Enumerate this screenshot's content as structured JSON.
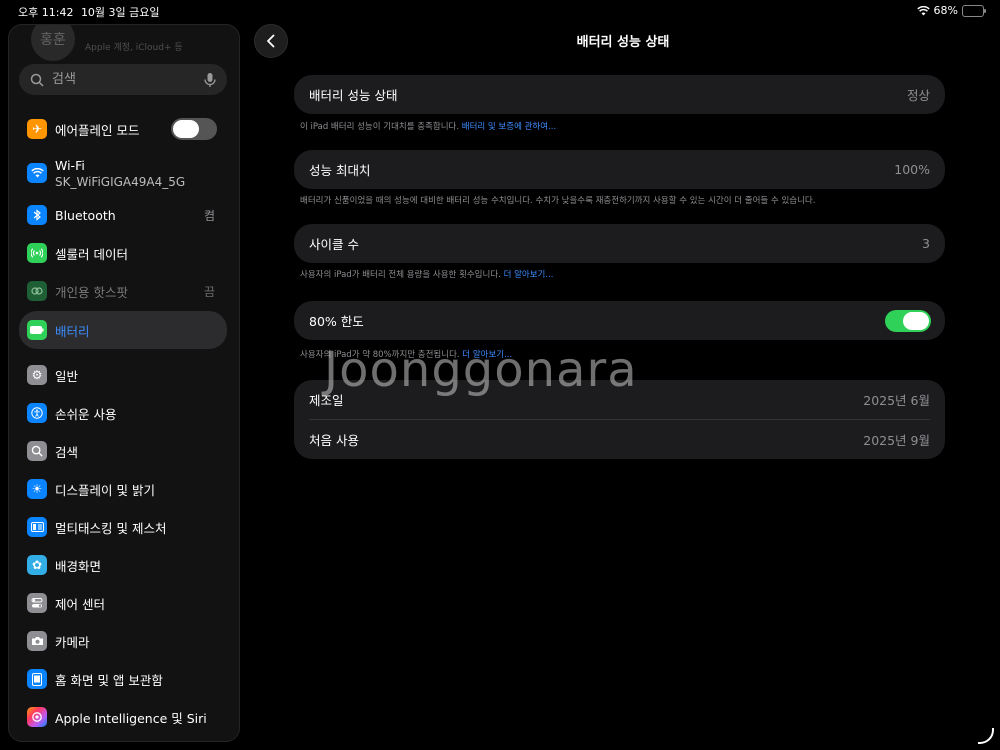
{
  "status": {
    "time": "오후 11:42",
    "date": "10월 3일 금요일",
    "battery_pct": "68%",
    "battery_level": 0.68
  },
  "profile": {
    "initials": "홍훈",
    "subtitle": "Apple 계정, iCloud+ 등"
  },
  "search": {
    "placeholder": "검색"
  },
  "sidebar": {
    "items": [
      {
        "label": "에어플레인 모드",
        "icon": "airplane-icon",
        "color": "#ff9500"
      },
      {
        "label": "Wi-Fi",
        "sub": "SK_WiFiGIGA49A4_5G",
        "icon": "wifi-icon",
        "color": "#0a84ff"
      },
      {
        "label": "Bluetooth",
        "value": "켬",
        "icon": "bluetooth-icon",
        "color": "#0a84ff"
      },
      {
        "label": "셀룰러 데이터",
        "icon": "cellular-icon",
        "color": "#30d158"
      },
      {
        "label": "개인용 핫스팟",
        "value": "끔",
        "icon": "hotspot-icon",
        "color": "#30d158"
      },
      {
        "label": "배터리",
        "icon": "battery-icon",
        "color": "#30d158"
      },
      {
        "label": "일반",
        "icon": "gear-icon",
        "color": "#8e8e93"
      },
      {
        "label": "손쉬운 사용",
        "icon": "accessibility-icon",
        "color": "#0a84ff"
      },
      {
        "label": "검색",
        "icon": "search-icon",
        "color": "#8e8e93"
      },
      {
        "label": "디스플레이 및 밝기",
        "icon": "brightness-icon",
        "color": "#0a84ff"
      },
      {
        "label": "멀티태스킹 및 제스처",
        "icon": "multitasking-icon",
        "color": "#0a84ff"
      },
      {
        "label": "배경화면",
        "icon": "wallpaper-icon",
        "color": "#32ade6"
      },
      {
        "label": "제어 센터",
        "icon": "control-center-icon",
        "color": "#8e8e93"
      },
      {
        "label": "카메라",
        "icon": "camera-icon",
        "color": "#8e8e93"
      },
      {
        "label": "홈 화면 및 앱 보관함",
        "icon": "home-screen-icon",
        "color": "#0a84ff"
      },
      {
        "label": "Apple Intelligence 및 Siri",
        "icon": "siri-icon",
        "color": "#bf5af2"
      }
    ]
  },
  "detail": {
    "title": "배터리 성능 상태",
    "health": {
      "label": "배터리 성능 상태",
      "value": "정상",
      "note": "이 iPad 배터리 성능이 기대치를 충족합니다.",
      "link": "배터리 및 보증에 관하여..."
    },
    "max_capacity": {
      "label": "성능 최대치",
      "value": "100%",
      "note": "배터리가 신품이었을 때의 성능에 대비한 배터리 성능 수치입니다. 수치가 낮을수록 재충전하기까지 사용할 수 있는 시간이 더 줄어들 수 있습니다."
    },
    "cycle": {
      "label": "사이클 수",
      "value": "3",
      "note": "사용자의 iPad가 배터리 전체 용량을 사용한 횟수입니다.",
      "link": "더 알아보기..."
    },
    "limit": {
      "label": "80% 한도",
      "note": "사용자의 iPad가 약 80%까지만 충전됩니다.",
      "link": "더 알아보기..."
    },
    "manufactured": {
      "label": "제조일",
      "value": "2025년 6월"
    },
    "first_use": {
      "label": "처음 사용",
      "value": "2025년 9월"
    }
  },
  "watermark": "Joonggonara",
  "colors": {
    "accent": "#3b8cff",
    "toggle_on": "#30d158"
  }
}
